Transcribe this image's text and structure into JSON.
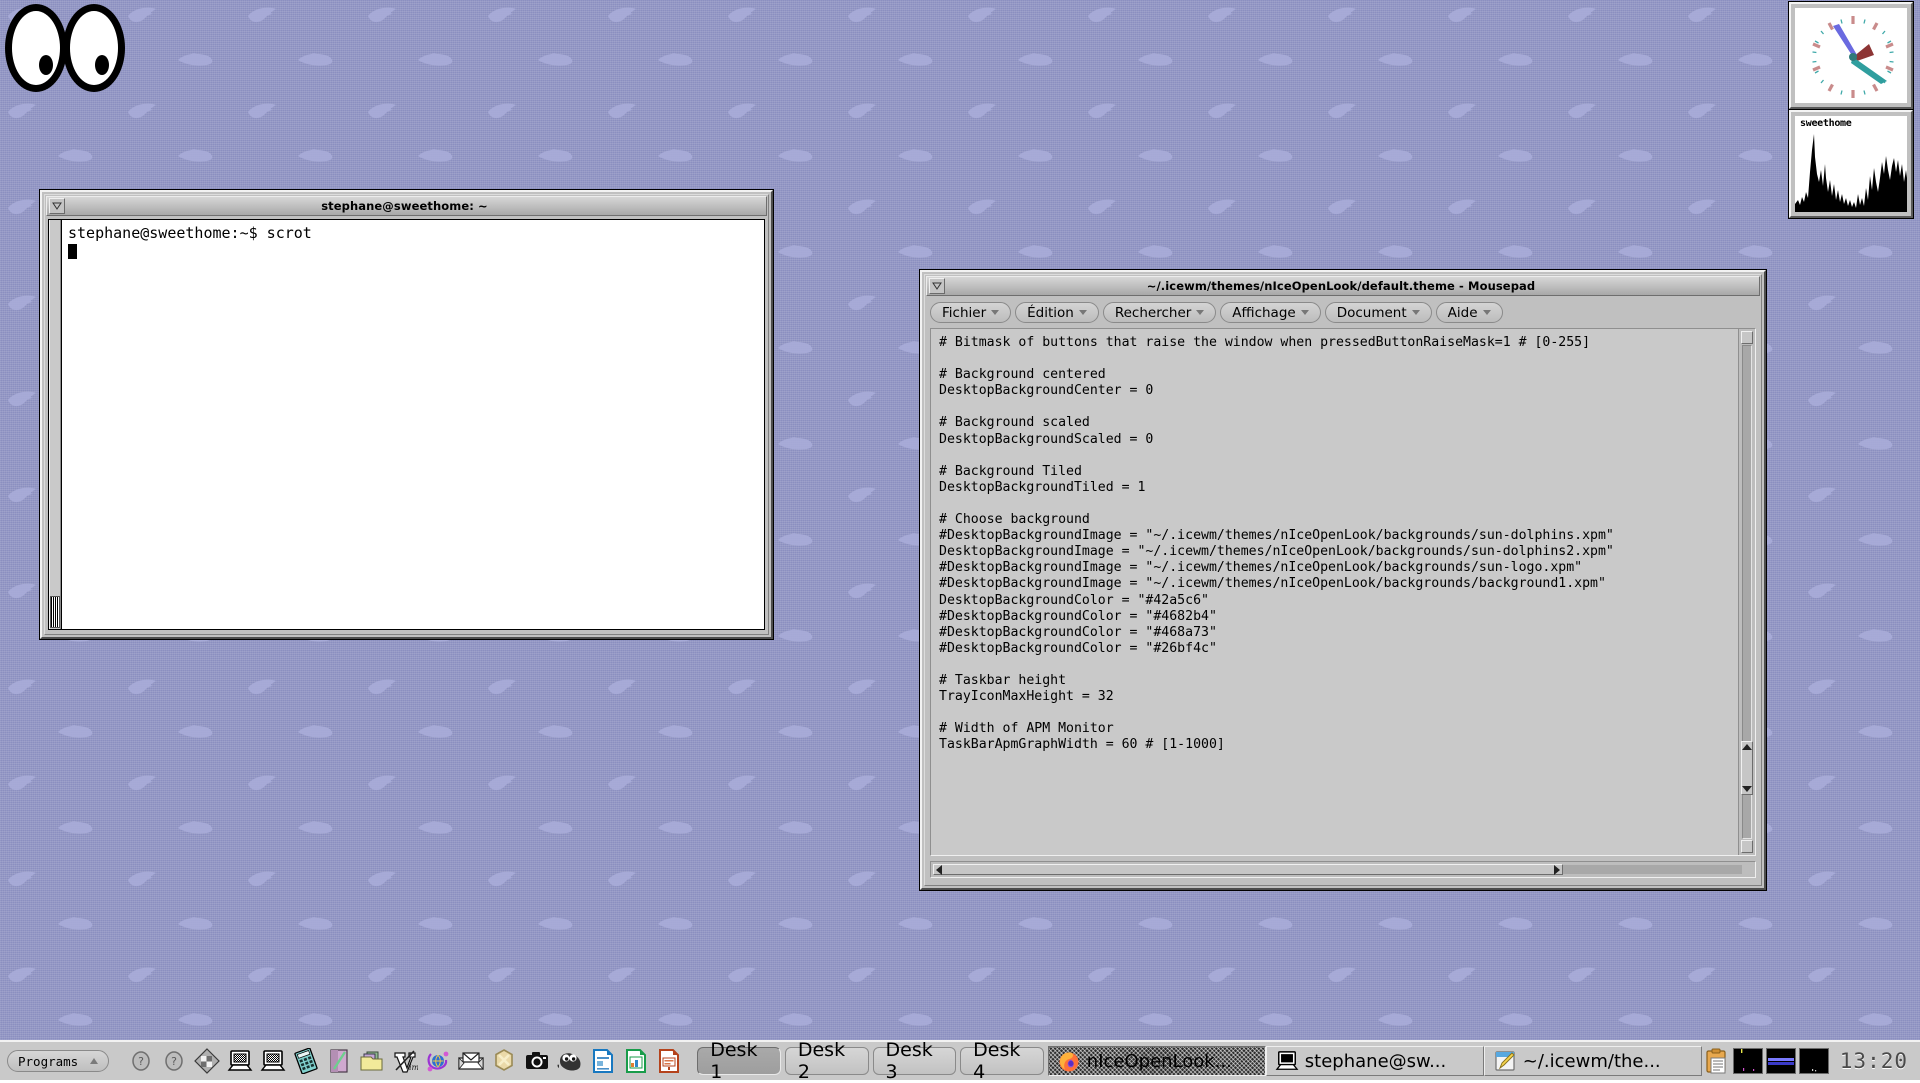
{
  "desktop": {
    "background_color": "#8b8fc0",
    "wallpaper": "sun-dolphins2.xpm"
  },
  "xeyes": {
    "name": "xeyes"
  },
  "xclock": {
    "name": "xclock",
    "time_shown": "13:20"
  },
  "xload": {
    "label": "sweethome"
  },
  "terminal": {
    "title": "stephane@sweethome: ~",
    "prompt_line": "stephane@sweethome:~$ scrot"
  },
  "mousepad": {
    "title": "~/.icewm/themes/nIceOpenLook/default.theme - Mousepad",
    "menus": [
      {
        "label": "Fichier"
      },
      {
        "label": "Édition"
      },
      {
        "label": "Rechercher"
      },
      {
        "label": "Affichage"
      },
      {
        "label": "Document"
      },
      {
        "label": "Aide"
      }
    ],
    "text": "# Bitmask of buttons that raise the window when pressedButtonRaiseMask=1 # [0-255]\n\n# Background centered\nDesktopBackgroundCenter = 0\n\n# Background scaled\nDesktopBackgroundScaled = 0\n\n# Background Tiled\nDesktopBackgroundTiled = 1\n\n# Choose background\n#DesktopBackgroundImage = \"~/.icewm/themes/nIceOpenLook/backgrounds/sun-dolphins.xpm\"\nDesktopBackgroundImage = \"~/.icewm/themes/nIceOpenLook/backgrounds/sun-dolphins2.xpm\"\n#DesktopBackgroundImage = \"~/.icewm/themes/nIceOpenLook/backgrounds/sun-logo.xpm\"\n#DesktopBackgroundImage = \"~/.icewm/themes/nIceOpenLook/backgrounds/background1.xpm\"\nDesktopBackgroundColor = \"#42a5c6\"\n#DesktopBackgroundColor = \"#4682b4\"\n#DesktopBackgroundColor = \"#468a73\"\n#DesktopBackgroundColor = \"#26bf4c\"\n\n# Taskbar height\nTrayIconMaxHeight = 32\n\n# Width of APM Monitor\nTaskBarApmGraphWidth = 60 # [1-1000]"
  },
  "taskbar": {
    "programs_label": "Programs",
    "launchers": [
      {
        "name": "help-icon"
      },
      {
        "name": "help-icon-2"
      },
      {
        "name": "window-tiler-icon"
      },
      {
        "name": "terminal-icon"
      },
      {
        "name": "terminal-icon-2"
      },
      {
        "name": "calculator-icon"
      },
      {
        "name": "text-editor-icon"
      },
      {
        "name": "file-manager-icon"
      },
      {
        "name": "vim-icon"
      },
      {
        "name": "network-icon"
      },
      {
        "name": "mail-icon"
      },
      {
        "name": "x-app-icon"
      },
      {
        "name": "camera-icon"
      },
      {
        "name": "gimp-icon"
      },
      {
        "name": "libreoffice-writer-icon"
      },
      {
        "name": "libreoffice-calc-icon"
      },
      {
        "name": "libreoffice-impress-icon"
      }
    ],
    "desks": [
      {
        "label": "Desk 1",
        "active": true
      },
      {
        "label": "Desk 2",
        "active": false
      },
      {
        "label": "Desk 3",
        "active": false
      },
      {
        "label": "Desk 4",
        "active": false
      }
    ],
    "tasks": [
      {
        "label": "nIceOpenLook...",
        "icon": "firefox-icon",
        "active": true
      },
      {
        "label": "stephane@sw...",
        "icon": "terminal-icon",
        "active": false
      },
      {
        "label": "~/.icewm/the...",
        "icon": "mousepad-icon",
        "active": false
      }
    ],
    "tray": [
      {
        "name": "clipboard-icon"
      },
      {
        "name": "cpu-monitor"
      },
      {
        "name": "net-monitor"
      },
      {
        "name": "mem-monitor"
      }
    ],
    "clock": "13:20"
  }
}
